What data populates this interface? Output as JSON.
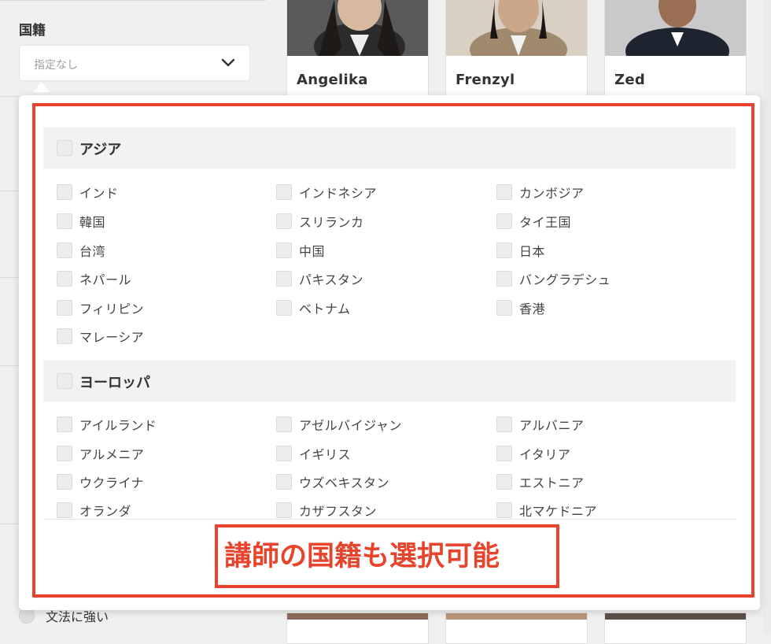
{
  "filter": {
    "nationality_label": "国籍",
    "nationality_placeholder": "指定なし",
    "bottom_option_label": "文法に強い"
  },
  "teachers": [
    {
      "name": "Angelika"
    },
    {
      "name": "Frenzyl"
    },
    {
      "name": "Zed"
    }
  ],
  "dropdown": {
    "regions": [
      {
        "label": "アジア",
        "options": [
          "インド",
          "インドネシア",
          "カンボジア",
          "韓国",
          "スリランカ",
          "タイ王国",
          "台湾",
          "中国",
          "日本",
          "ネパール",
          "パキスタン",
          "バングラデシュ",
          "フィリピン",
          "ベトナム",
          "香港",
          "マレーシア"
        ]
      },
      {
        "label": "ヨーロッパ",
        "options": [
          "アイルランド",
          "アゼルバイジャン",
          "アルバニア",
          "アルメニア",
          "イギリス",
          "イタリア",
          "ウクライナ",
          "ウズベキスタン",
          "エストニア",
          "オランダ",
          "カザフスタン",
          "北マケドニア"
        ]
      }
    ]
  },
  "annotation": {
    "text": "講師の国籍も選択可能",
    "color": "#e8432c"
  }
}
